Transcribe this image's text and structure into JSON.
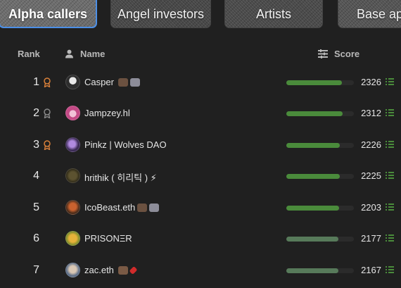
{
  "tabs": [
    {
      "label": "Alpha callers"
    },
    {
      "label": "Angel investors"
    },
    {
      "label": "Artists"
    },
    {
      "label": "Base ap"
    }
  ],
  "header": {
    "rank_label": "Rank",
    "name_label": "Name",
    "score_label": "Score"
  },
  "colors": {
    "bar_active": "#4a8b3b",
    "bar_dim": "#577a5a",
    "medal_gold": "#d9803a",
    "medal_silver": "#8a8a8a",
    "tab_selected_border": "#4c8fe6"
  },
  "rows": [
    {
      "rank": "1",
      "name": "Casper",
      "score": "2326",
      "medal": "gold",
      "score_fraction": 0.82
    },
    {
      "rank": "2",
      "name": "Jampzey.hl",
      "score": "2312",
      "medal": "silver",
      "score_fraction": 0.83
    },
    {
      "rank": "3",
      "name": "Pinkz | Wolves DAO",
      "score": "2226",
      "medal": "gold",
      "score_fraction": 0.79
    },
    {
      "rank": "4",
      "name": "hrithik ( 히리틱 ) ⚡",
      "score": "2225",
      "medal": "",
      "score_fraction": 0.79
    },
    {
      "rank": "5",
      "name": "IcoBeast.eth",
      "score": "2203",
      "medal": "",
      "score_fraction": 0.78
    },
    {
      "rank": "6",
      "name": "PRISONΞR",
      "score": "2177",
      "medal": "",
      "score_fraction": 0.77
    },
    {
      "rank": "7",
      "name": "zac.eth",
      "score": "2167",
      "medal": "",
      "score_fraction": 0.77
    }
  ]
}
